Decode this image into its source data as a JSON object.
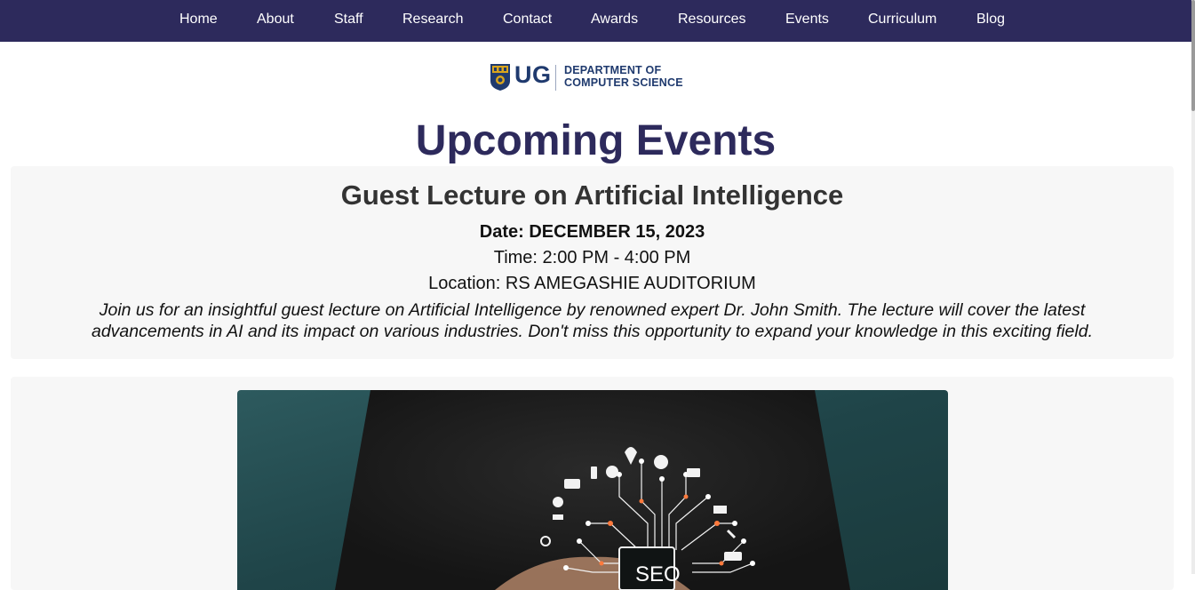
{
  "nav": {
    "items": [
      {
        "label": "Home"
      },
      {
        "label": "About"
      },
      {
        "label": "Staff"
      },
      {
        "label": "Research"
      },
      {
        "label": "Contact"
      },
      {
        "label": "Awards"
      },
      {
        "label": "Resources"
      },
      {
        "label": "Events"
      },
      {
        "label": "Curriculum"
      },
      {
        "label": "Blog"
      }
    ]
  },
  "logo": {
    "mark": "UG",
    "line1": "DEPARTMENT OF",
    "line2": "COMPUTER SCIENCE"
  },
  "page": {
    "title": "Upcoming Events"
  },
  "event": {
    "title": "Guest Lecture on Artificial Intelligence",
    "date": "Date: DECEMBER 15, 2023",
    "time": "Time: 2:00 PM - 4:00 PM",
    "location": "Location: RS AMEGASHIE AUDITORIUM",
    "description": "Join us for an insightful guest lecture on Artificial Intelligence by renowned expert Dr. John Smith. The lecture will cover the latest advancements in AI and its impact on various industries. Don't miss this opportunity to expand your knowledge in this exciting field."
  },
  "image": {
    "chip_text": "SEO"
  },
  "colors": {
    "nav_bg": "#2d2a5c",
    "title": "#2d2a5c",
    "logo": "#1f3a6e",
    "card_bg": "#f7f7f7"
  }
}
